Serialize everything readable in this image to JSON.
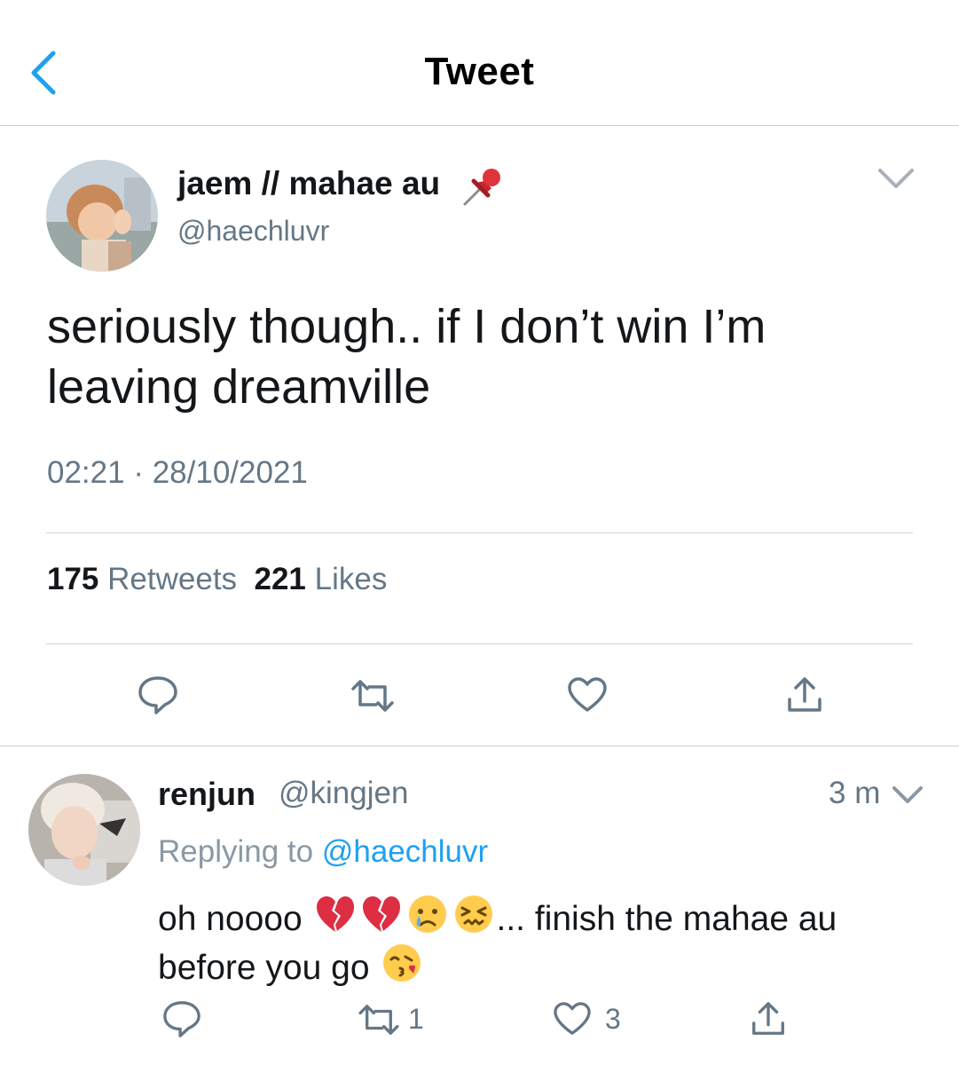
{
  "header": {
    "title": "Tweet"
  },
  "tweet": {
    "author_name": "jaem // mahae au",
    "author_handle": "@haechluvr",
    "text": "seriously though.. if I don’t win I’m leaving dreamville",
    "time": "02:21",
    "date": "28/10/2021",
    "separator": "·",
    "retweets_count": "175",
    "retweets_label": "Retweets",
    "likes_count": "221",
    "likes_label": "Likes"
  },
  "reply": {
    "author_name": "renjun",
    "author_handle": "@kingjen",
    "time": "3 m",
    "replying_prefix": "Replying to",
    "replying_mention": "@haechluvr",
    "text_part1": "oh noooo",
    "text_part2": "... finish the mahae au before you go",
    "emojis": [
      "broken-heart-emoji",
      "broken-heart-emoji",
      "crying-face-emoji",
      "confounded-face-emoji",
      "kissing-heart-emoji"
    ],
    "retweet_count": "1",
    "like_count": "3"
  },
  "colors": {
    "accent": "#1da1f2",
    "icon_gray": "#657786",
    "text": "#14171a"
  }
}
